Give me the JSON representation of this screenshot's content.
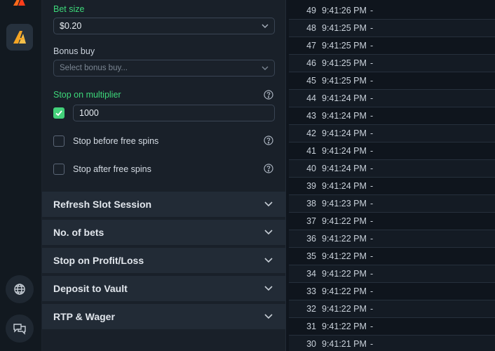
{
  "panel": {
    "bet_size_label": "Bet size",
    "bet_size_value": "$0.20",
    "bonus_buy_label": "Bonus buy",
    "bonus_buy_placeholder": "Select bonus buy...",
    "stop_multiplier_label": "Stop on multiplier",
    "stop_multiplier_checked": true,
    "stop_multiplier_value": "1000",
    "stop_before_free_spins": "Stop before free spins",
    "stop_after_free_spins": "Stop after free spins"
  },
  "accordions": [
    "Refresh Slot Session",
    "No. of bets",
    "Stop on Profit/Loss",
    "Deposit to Vault",
    "RTP & Wager"
  ],
  "bets": [
    {
      "num": "49",
      "time": "9:41:26 PM",
      "result": "-"
    },
    {
      "num": "48",
      "time": "9:41:25 PM",
      "result": "-"
    },
    {
      "num": "47",
      "time": "9:41:25 PM",
      "result": "-"
    },
    {
      "num": "46",
      "time": "9:41:25 PM",
      "result": "-"
    },
    {
      "num": "45",
      "time": "9:41:25 PM",
      "result": "-"
    },
    {
      "num": "44",
      "time": "9:41:24 PM",
      "result": "-"
    },
    {
      "num": "43",
      "time": "9:41:24 PM",
      "result": "-"
    },
    {
      "num": "42",
      "time": "9:41:24 PM",
      "result": "-"
    },
    {
      "num": "41",
      "time": "9:41:24 PM",
      "result": "-"
    },
    {
      "num": "40",
      "time": "9:41:24 PM",
      "result": "-"
    },
    {
      "num": "39",
      "time": "9:41:24 PM",
      "result": "-"
    },
    {
      "num": "38",
      "time": "9:41:23 PM",
      "result": "-"
    },
    {
      "num": "37",
      "time": "9:41:22 PM",
      "result": "-"
    },
    {
      "num": "36",
      "time": "9:41:22 PM",
      "result": "-"
    },
    {
      "num": "35",
      "time": "9:41:22 PM",
      "result": "-"
    },
    {
      "num": "34",
      "time": "9:41:22 PM",
      "result": "-"
    },
    {
      "num": "33",
      "time": "9:41:22 PM",
      "result": "-"
    },
    {
      "num": "32",
      "time": "9:41:22 PM",
      "result": "-"
    },
    {
      "num": "31",
      "time": "9:41:22 PM",
      "result": "-"
    },
    {
      "num": "30",
      "time": "9:41:21 PM",
      "result": "-"
    }
  ],
  "icons": {
    "rail_top": "brand-logo-icon",
    "rail_app": "app-logo-icon",
    "rail_language": "globe-icon",
    "rail_chat": "chat-icon"
  },
  "colors": {
    "accent_green": "#3dd87a",
    "brand_orange": "#f5a524"
  }
}
